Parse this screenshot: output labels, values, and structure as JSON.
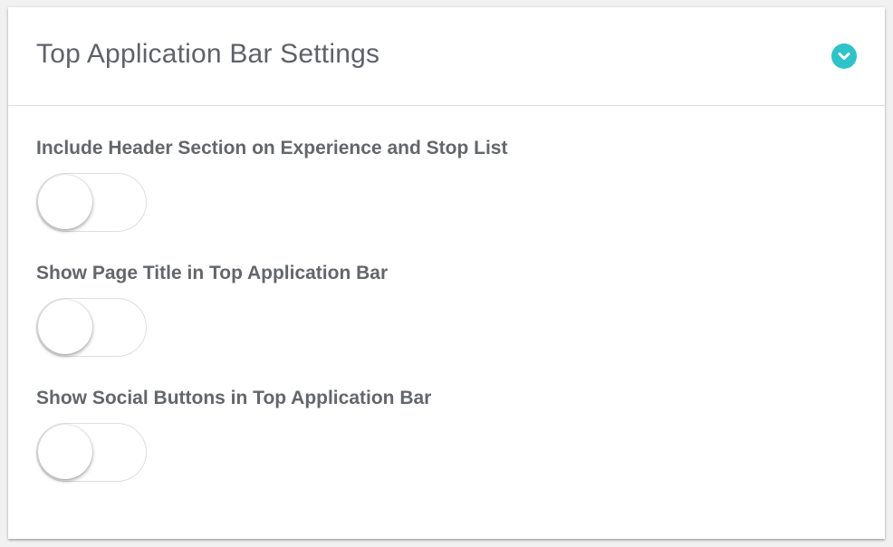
{
  "panel": {
    "title": "Top Application Bar Settings",
    "collapse_icon": "chevron-down-circle-icon",
    "accent_color": "#2ec3c9"
  },
  "settings": [
    {
      "label": "Include Header Section on Experience and Stop List",
      "enabled": false
    },
    {
      "label": "Show Page Title in Top Application Bar",
      "enabled": false
    },
    {
      "label": "Show Social Buttons in Top Application Bar",
      "enabled": false
    }
  ]
}
